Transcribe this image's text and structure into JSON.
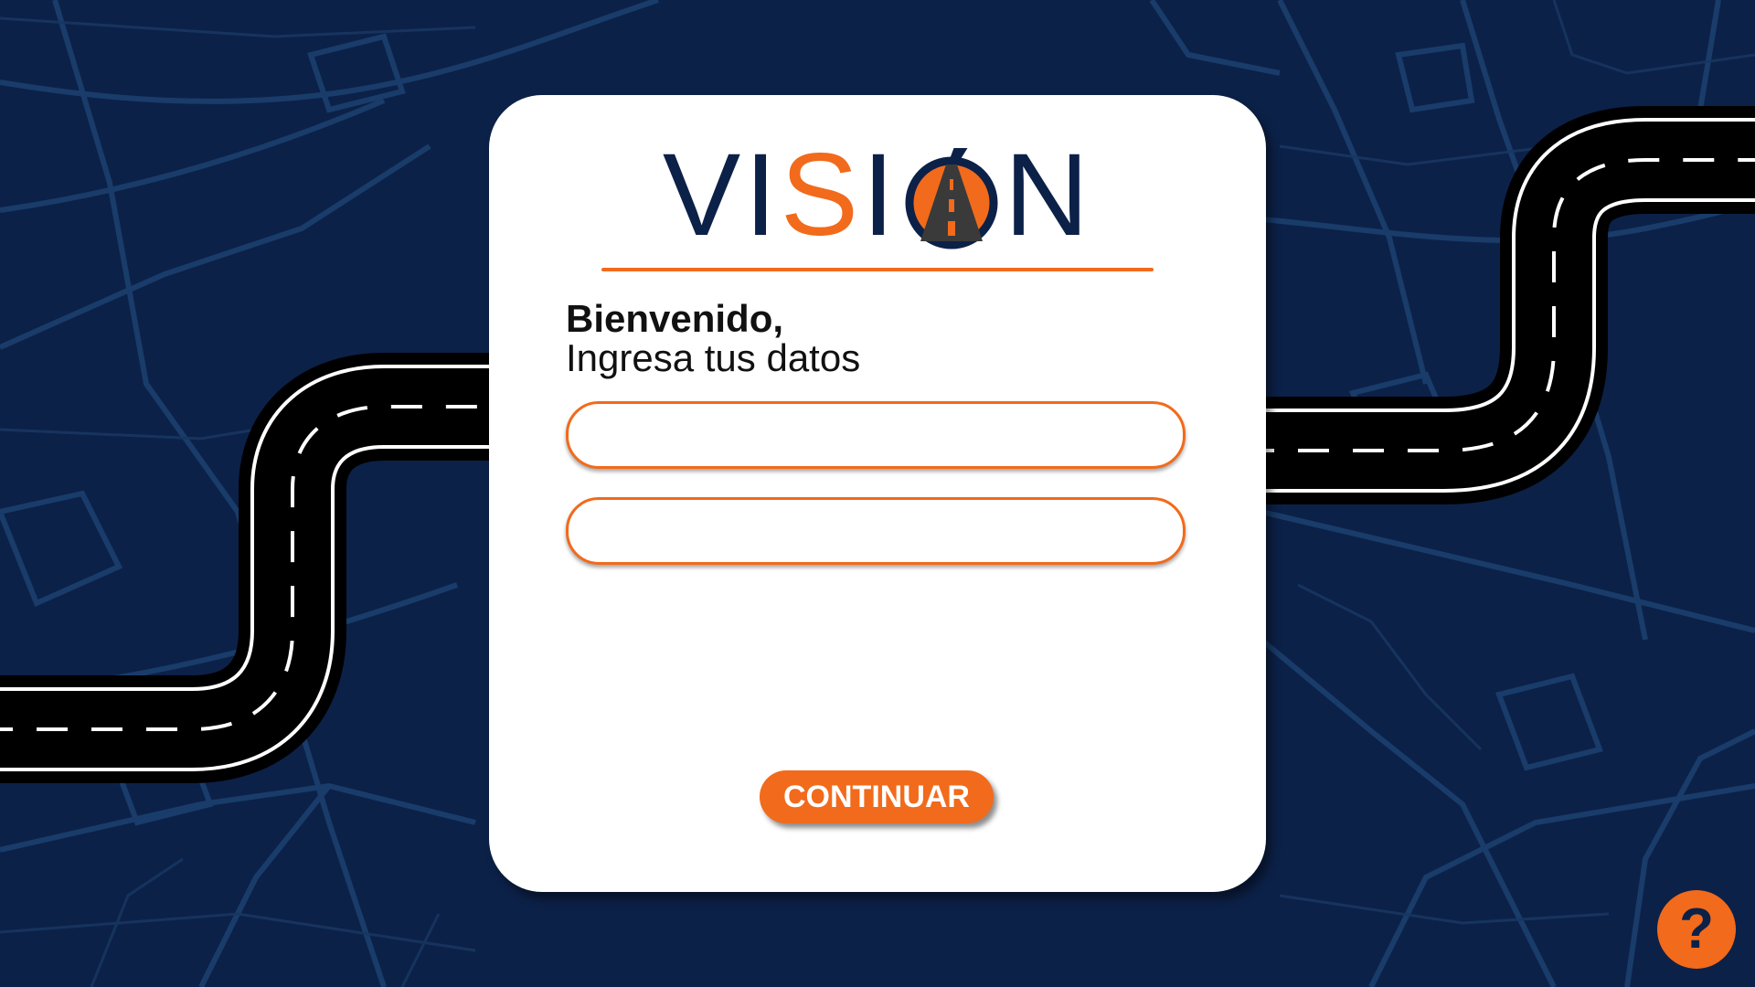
{
  "app": {
    "logo_prefix_1": "VI",
    "logo_accent": "S",
    "logo_prefix_2": "I",
    "logo_suffix": "N"
  },
  "login": {
    "title": "Bienvenido,",
    "subtitle": "Ingresa tus datos",
    "field_1": {
      "value": "",
      "placeholder": ""
    },
    "field_2": {
      "value": "",
      "placeholder": ""
    },
    "continue_label": "CONTINUAR"
  },
  "help": {
    "label": "?"
  },
  "colors": {
    "background": "#0c2148",
    "accent": "#f26a1b",
    "card": "#ffffff",
    "road": "#000000"
  },
  "icons": {
    "logo_o": "road-in-circle-icon",
    "help": "question-mark-icon"
  }
}
